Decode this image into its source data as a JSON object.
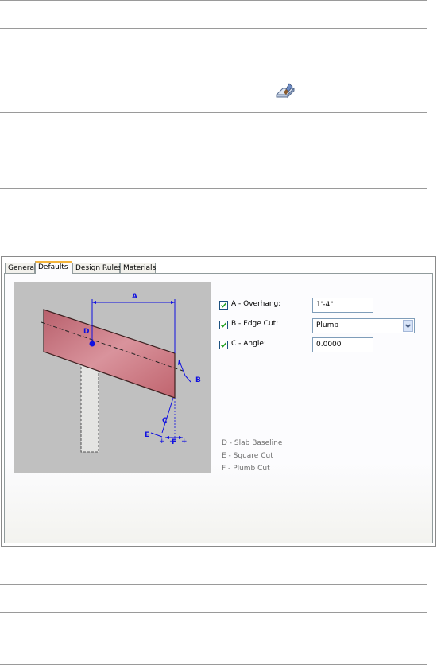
{
  "tabs": [
    {
      "label": "General",
      "active": false
    },
    {
      "label": "Defaults",
      "active": true
    },
    {
      "label": "Design Rules",
      "active": false
    },
    {
      "label": "Materials",
      "active": false
    }
  ],
  "properties": {
    "overhang": {
      "label": "A - Overhang:",
      "checked": true,
      "value": "1'-4\""
    },
    "edge_cut": {
      "label": "B - Edge Cut:",
      "checked": true,
      "value": "Plumb"
    },
    "angle": {
      "label": "C - Angle:",
      "checked": true,
      "value": "0.0000"
    }
  },
  "legend": [
    "D - Slab Baseline",
    "E - Square Cut",
    "F - Plumb Cut"
  ],
  "diagram_labels": {
    "a": "A",
    "b": "B",
    "c": "C",
    "d": "D",
    "e": "E",
    "f": "F"
  },
  "colors": {
    "accent_blue": "#1010e0",
    "tab_highlight": "#f4b43c",
    "slab_red": "#c8707a"
  },
  "icons": {
    "toolbar": "paint-brush-icon",
    "dropdown": "chevron-down-icon",
    "check": "check-icon"
  }
}
